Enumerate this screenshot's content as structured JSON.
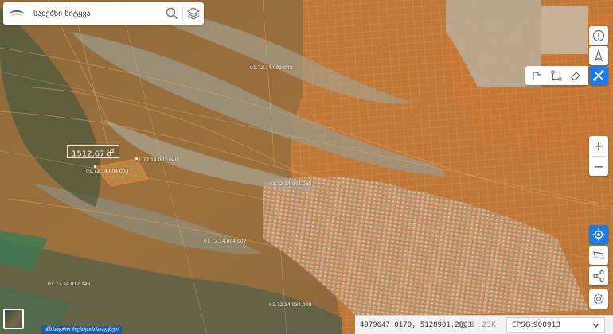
{
  "search": {
    "placeholder": "საძებნი სიტყვა"
  },
  "measurement": {
    "value": "1512.67",
    "unit": "მ",
    "unit_power": "2"
  },
  "map_labels": [
    "01.72.14.002.042",
    "01.72.14.004.003",
    "01.72.14.041.065",
    "01.72.14.012.146",
    "01.72.14.034.008",
    "01.72.14.004.002",
    "01.72.14.002.040"
  ],
  "footer": {
    "agency_label": "ამზ საჯარო რეესტრის სააგენტო",
    "coordinates": "4979647.0170, 5128901.2803",
    "scale": "1 : 23K",
    "projection": "EPSG:900913"
  },
  "colors": {
    "accent": "#1e7be1",
    "parcel_outline": "#e8722a",
    "tooltip_bg": "#705e3c"
  },
  "icons": {
    "search": "search-icon",
    "layers": "layers-icon",
    "info": "info-icon",
    "north_arrow": "north-arrow-icon",
    "measure_line": "measure-line-icon",
    "measure_area": "measure-area-icon",
    "eraser": "eraser-icon",
    "ruler": "ruler-tool-icon",
    "locate": "locate-icon",
    "share": "share-icon",
    "settings": "settings-icon"
  }
}
